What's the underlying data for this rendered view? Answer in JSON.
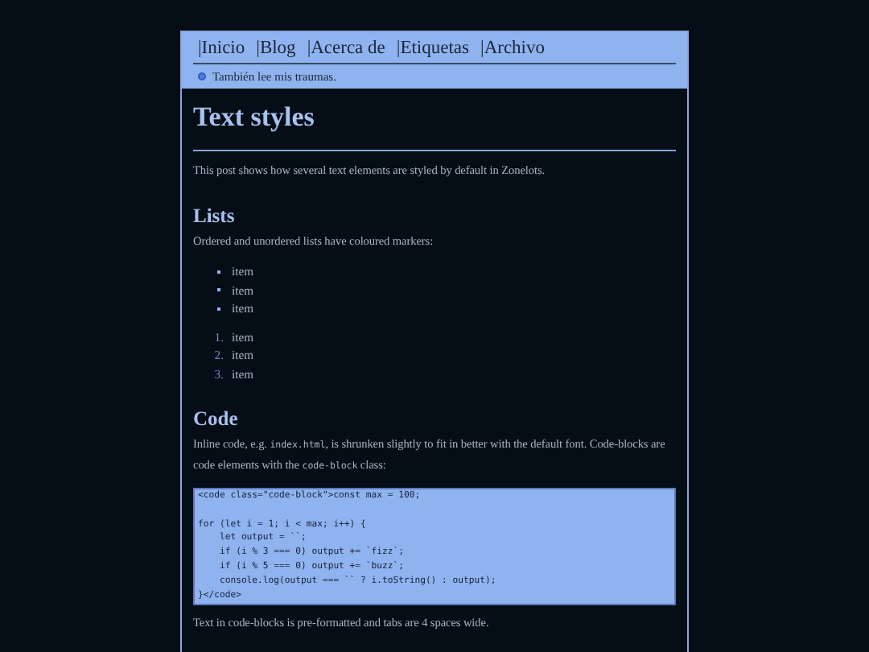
{
  "nav": [
    {
      "label": "|Inicio"
    },
    {
      "label": "|Blog"
    },
    {
      "label": "|Acerca de"
    },
    {
      "label": "|Etiquetas"
    },
    {
      "label": "|Archivo"
    }
  ],
  "status": {
    "text": "También lee mis traumas."
  },
  "title": "Text styles",
  "intro": "This post shows how several text elements are styled by default in Zonelots.",
  "sections": [
    {
      "heading": "Lists",
      "text": [
        {
          "kind": "text",
          "value": "Ordered and unordered lists have coloured markers:"
        }
      ],
      "unordered": [
        "item",
        "item",
        "item"
      ],
      "ordered": [
        {
          "number": "1.",
          "label": "item"
        },
        {
          "number": "2.",
          "label": "item"
        },
        {
          "number": "3.",
          "label": "item"
        }
      ]
    },
    {
      "heading": "Code",
      "text": [
        {
          "kind": "text",
          "value": "Inline code, e.g. "
        },
        {
          "kind": "code",
          "value": "index.html"
        },
        {
          "kind": "text",
          "value": ", is shrunken slightly to fit in better with the default font. Code-blocks are code elements with the "
        },
        {
          "kind": "code",
          "value": "code-block"
        },
        {
          "kind": "text",
          "value": " class:"
        }
      ],
      "code_block": "<code class=\"code-block\">const max = 100;\n\nfor (let i = 1; i < max; i++) {\n    let output = ``;\n    if (i % 3 === 0) output += `fizz`;\n    if (i % 5 === 0) output += `buzz`;\n    console.log(output === `` ? i.toString() : output);\n}</code>",
      "after": "Text in code-blocks is pre-formatted and tabs are 4 spaces wide."
    }
  ]
}
